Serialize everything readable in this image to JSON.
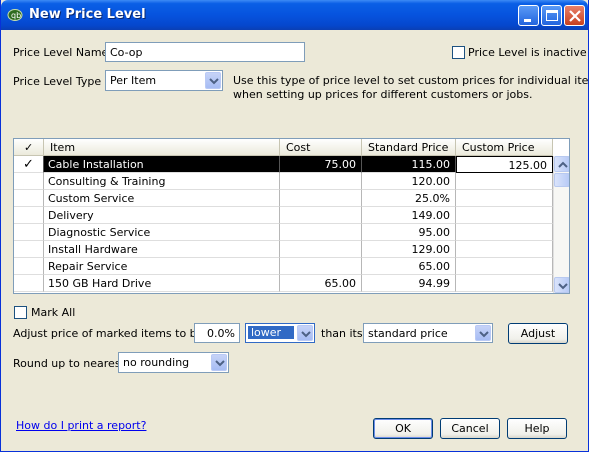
{
  "window": {
    "title": "New Price Level"
  },
  "form": {
    "name_label": "Price Level Name",
    "name_value": "Co-op",
    "inactive_label": "Price Level is inactive",
    "type_label": "Price Level Type",
    "type_value": "Per Item",
    "description_line1": "Use this type of price level to set custom prices for individual items",
    "description_line2": "when setting up prices for different customers or jobs."
  },
  "table": {
    "headers": {
      "check": "✓",
      "item": "Item",
      "cost": "Cost",
      "standard": "Standard Price",
      "custom": "Custom Price"
    },
    "rows": [
      {
        "check": "✓",
        "item": "Cable Installation",
        "cost": "75.00",
        "standard": "115.00",
        "custom": "125.00"
      },
      {
        "check": "",
        "item": "Consulting & Training",
        "cost": "",
        "standard": "120.00",
        "custom": ""
      },
      {
        "check": "",
        "item": "Custom Service",
        "cost": "",
        "standard": "25.0%",
        "custom": ""
      },
      {
        "check": "",
        "item": "Delivery",
        "cost": "",
        "standard": "149.00",
        "custom": ""
      },
      {
        "check": "",
        "item": "Diagnostic Service",
        "cost": "",
        "standard": "95.00",
        "custom": ""
      },
      {
        "check": "",
        "item": "Install Hardware",
        "cost": "",
        "standard": "129.00",
        "custom": ""
      },
      {
        "check": "",
        "item": "Repair Service",
        "cost": "",
        "standard": "65.00",
        "custom": ""
      },
      {
        "check": "",
        "item": "150 GB Hard Drive",
        "cost": "65.00",
        "standard": "94.99",
        "custom": ""
      }
    ]
  },
  "adjust": {
    "mark_all_label": "Mark All",
    "adjust_label": "Adjust price of marked items to be",
    "percent_value": "0.0%",
    "direction_value": "lower",
    "than_its_label": "than its",
    "basis_value": "standard price",
    "adjust_button": "Adjust",
    "round_label": "Round up to nearest",
    "round_value": "no rounding"
  },
  "footer": {
    "help_link": "How do I print a report?",
    "ok_button": "OK",
    "cancel_button": "Cancel",
    "help_button": "Help"
  },
  "icons": {
    "app": "quickbooks-icon",
    "minimize": "minimize-icon",
    "maximize": "maximize-icon",
    "close": "close-icon"
  }
}
